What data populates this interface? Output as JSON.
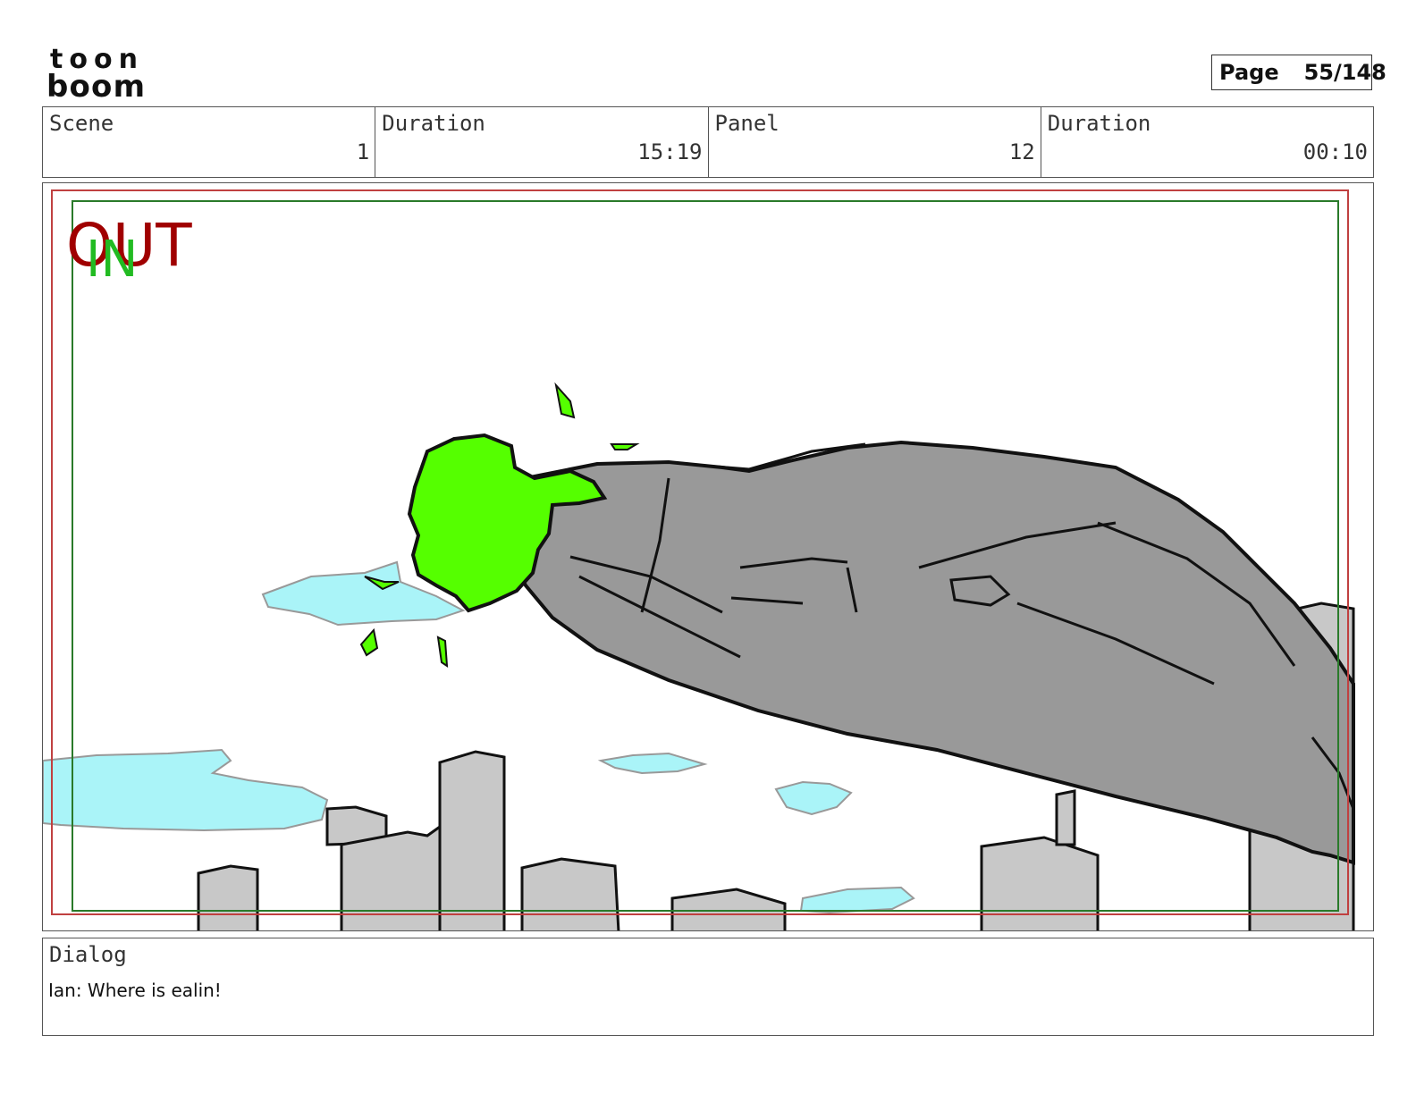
{
  "header": {
    "logo_text_top": "toon",
    "logo_text_bottom": "boom",
    "page_label": "Page",
    "page_value": "55/148"
  },
  "info": {
    "scene_label": "Scene",
    "scene_value": "1",
    "duration_label": "Duration",
    "duration_value": "15:19",
    "panel_label": "Panel",
    "panel_value": "12",
    "panel_duration_label": "Duration",
    "panel_duration_value": "00:10"
  },
  "panel": {
    "marker_out": "OUT",
    "marker_in": "IN",
    "colors": {
      "out_marker": "#a00000",
      "in_marker": "#22bb22",
      "safe_frame_red": "#c04040",
      "safe_frame_green": "#2a7a2a",
      "blob_green": "#55ff00",
      "vehicle_gray": "#999999",
      "building_gray": "#c8c8c8",
      "cloud_cyan": "#aaf4f8"
    }
  },
  "dialog": {
    "label": "Dialog",
    "text": "Ian: Where is ealin!"
  }
}
